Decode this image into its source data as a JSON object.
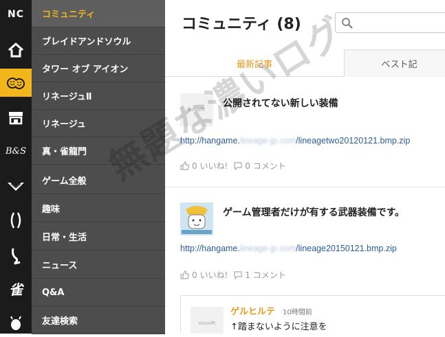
{
  "rail": {
    "items": [
      {
        "icon": "nc-logo-icon",
        "label": "NC"
      },
      {
        "icon": "home-icon"
      },
      {
        "icon": "community-smiley-icon"
      },
      {
        "icon": "shop-icon"
      },
      {
        "icon": "bns-logo-icon",
        "label": "B&S"
      },
      {
        "icon": "wings-icon"
      },
      {
        "icon": "aion-logo-icon"
      },
      {
        "icon": "lineage-logo-icon"
      },
      {
        "icon": "jin-logo-icon",
        "label": "雀"
      },
      {
        "icon": "bug-icon"
      }
    ]
  },
  "nav": {
    "items": [
      {
        "label": "コミュニティ"
      },
      {
        "label": "ブレイドアンドソウル"
      },
      {
        "label": "タワー オブ アイオン"
      },
      {
        "label": "リネージュⅡ"
      },
      {
        "label": "リネージュ"
      },
      {
        "label": "真・雀龍門"
      },
      {
        "label": "ゲーム全般"
      },
      {
        "label": "趣味"
      },
      {
        "label": "日常・生活"
      },
      {
        "label": "ニュース"
      },
      {
        "label": "Q&A"
      },
      {
        "label": "友達検索"
      }
    ]
  },
  "header": {
    "title": "コミュニティ (8)"
  },
  "tabs": [
    {
      "label": "最新記事"
    },
    {
      "label": "ベスト記"
    }
  ],
  "posts": [
    {
      "title": "公開されてない新しい装備",
      "link_prefix": "http://hangame.",
      "link_blurred": "lineage-jp.com",
      "link_suffix": "/lineagetwo20120121.bmp.zip",
      "likes": "0",
      "like_label": "いいね!",
      "comments": "0",
      "comment_label": "コメント",
      "thumb_logo": "ncsoft"
    },
    {
      "title": "ゲーム管理者だけが有する武器装備です。",
      "link_prefix": "http://hangame.",
      "link_blurred": "lineage-jp.com",
      "link_suffix": "/lineage20150121.bmp.zip",
      "likes": "0",
      "like_label": "いいね!",
      "comments": "1",
      "comment_label": "コメント"
    }
  ],
  "comment": {
    "author": "ゲルヒルテ",
    "time": "10時間前",
    "text": "↑踏まないように注意を",
    "thumb_logo": "ncsoft"
  },
  "watermark": "無題な濃いログ",
  "colors": {
    "rail_bg": "#1b1b1b",
    "accent": "#f3b61a",
    "nav_bg": "#4d4d4d",
    "link": "#2a5c9a",
    "tab_active_text": "#e69a1b"
  }
}
